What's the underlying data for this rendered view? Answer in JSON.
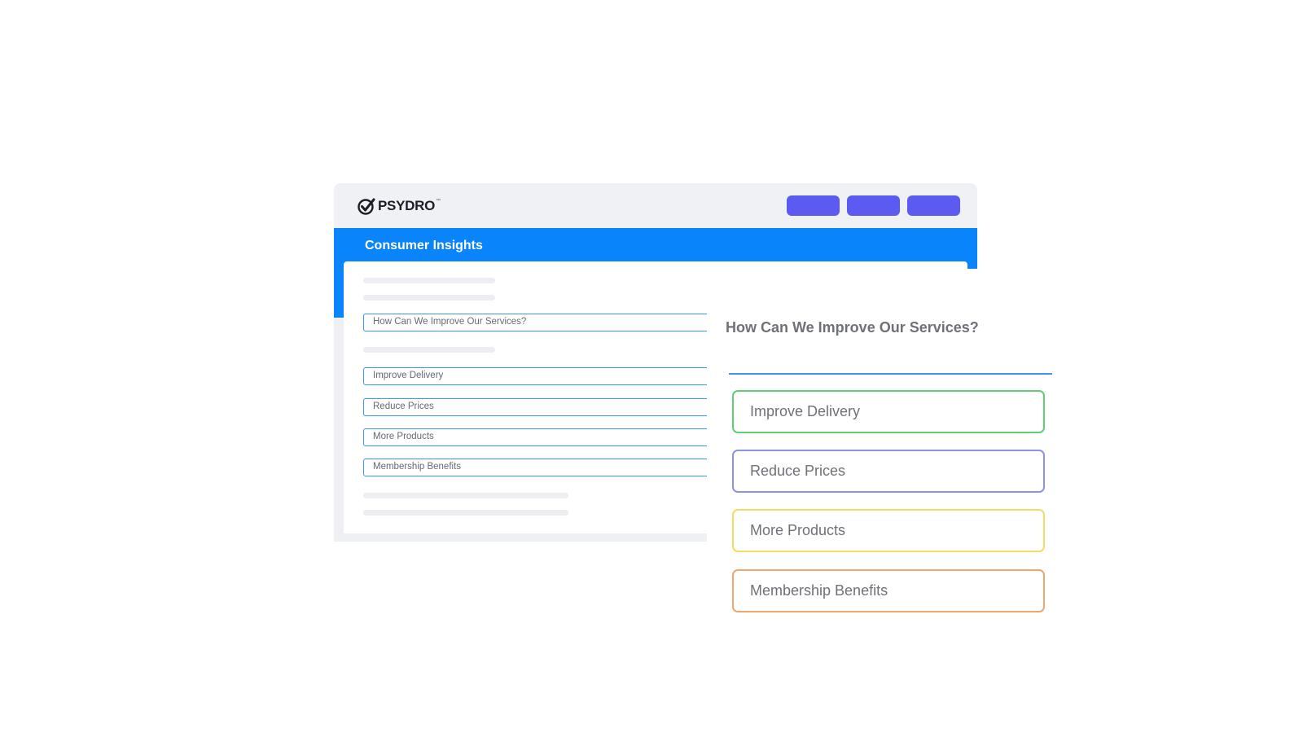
{
  "app": {
    "logo_text": "PSYDRO",
    "logo_tm": "™",
    "logo_icon": "checkmark-circle-icon",
    "section_title": "Consumer Insights"
  },
  "form": {
    "question_field": "How Can We Improve Our Services?",
    "options": [
      "Improve Delivery",
      "Reduce Prices",
      "More Products",
      "Membership Benefits"
    ]
  },
  "panel": {
    "question": "How Can We Improve Our Services?",
    "options": [
      {
        "label": "Improve Delivery",
        "color": "#5fcf75"
      },
      {
        "label": "Reduce Prices",
        "color": "#8c92e8"
      },
      {
        "label": "More Products",
        "color": "#f4dc63"
      },
      {
        "label": "Membership Benefits",
        "color": "#f2a66b"
      }
    ]
  },
  "colors": {
    "accent_blue": "#0a84fb",
    "button_purple": "#5b5bf2",
    "field_border": "#3d94f5"
  }
}
